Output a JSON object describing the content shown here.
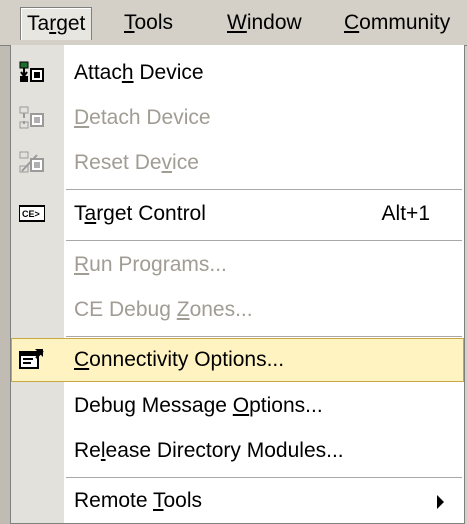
{
  "menubar": {
    "items": [
      {
        "label": "Target",
        "mnemonic_index": 2
      },
      {
        "label": "Tools",
        "mnemonic_index": 0
      },
      {
        "label": "Window",
        "mnemonic_index": 0
      },
      {
        "label": "Community",
        "mnemonic_index": 0
      }
    ]
  },
  "menu": {
    "items": [
      {
        "label_pre": "Attac",
        "label_ul": "h",
        "label_post": " Device",
        "icon": "attach-device-icon",
        "enabled": true
      },
      {
        "label_pre": "",
        "label_ul": "D",
        "label_post": "etach Device",
        "icon": "detach-device-icon",
        "enabled": false
      },
      {
        "label_pre": "Reset De",
        "label_ul": "v",
        "label_post": "ice",
        "icon": "reset-device-icon",
        "enabled": false
      },
      {
        "label_pre": "T",
        "label_ul": "a",
        "label_post": "rget Control",
        "icon": "target-control-icon",
        "shortcut": "Alt+1",
        "enabled": true
      },
      {
        "label_pre": "",
        "label_ul": "R",
        "label_post": "un Programs...",
        "enabled": false
      },
      {
        "label_pre": "CE Debug ",
        "label_ul": "Z",
        "label_post": "ones...",
        "enabled": false
      },
      {
        "label_pre": "",
        "label_ul": "C",
        "label_post": "onnectivity Options...",
        "icon": "connectivity-options-icon",
        "enabled": true,
        "selected": true
      },
      {
        "label_pre": "Debug Message ",
        "label_ul": "O",
        "label_post": "ptions...",
        "enabled": true
      },
      {
        "label_pre": "Re",
        "label_ul": "l",
        "label_post": "ease Directory Modules...",
        "enabled": true
      },
      {
        "label_pre": "Remote ",
        "label_ul": "T",
        "label_post": "ools",
        "enabled": true,
        "submenu": true
      }
    ]
  }
}
